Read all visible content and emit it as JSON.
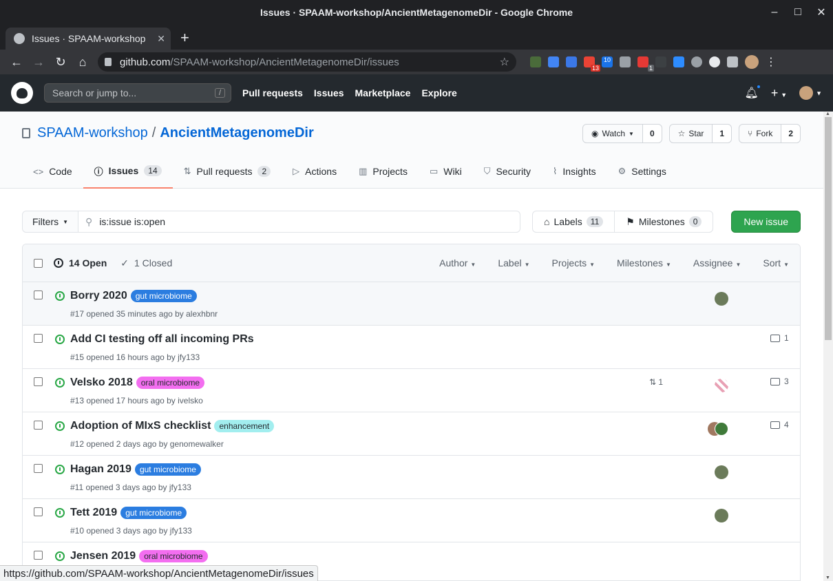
{
  "window": {
    "title": "Issues · SPAAM-workshop/AncientMetagenomeDir - Google Chrome"
  },
  "browser": {
    "tab_title": "Issues · SPAAM-workshop",
    "url_host": "github.com",
    "url_path": "/SPAAM-workshop/AncientMetagenomeDir/issues",
    "ext_badge_mail": "13",
    "ext_badge_calendar": "10",
    "ext_badge_other": "1"
  },
  "gh": {
    "search_placeholder": "Search or jump to...",
    "slash": "/",
    "nav": [
      "Pull requests",
      "Issues",
      "Marketplace",
      "Explore"
    ]
  },
  "repo": {
    "owner": "SPAAM-workshop",
    "sep": "/",
    "name": "AncientMetagenomeDir",
    "watch_label": "Watch",
    "watch_count": "0",
    "star_label": "Star",
    "star_count": "1",
    "fork_label": "Fork",
    "fork_count": "2",
    "tabs": {
      "code": "Code",
      "issues": "Issues",
      "issues_count": "14",
      "pulls": "Pull requests",
      "pulls_count": "2",
      "actions": "Actions",
      "projects": "Projects",
      "wiki": "Wiki",
      "security": "Security",
      "insights": "Insights",
      "settings": "Settings"
    }
  },
  "subnav": {
    "filters": "Filters",
    "query": "is:issue is:open",
    "labels": "Labels",
    "labels_count": "11",
    "milestones": "Milestones",
    "milestones_count": "0",
    "new_issue": "New issue"
  },
  "list_header": {
    "open": "14 Open",
    "closed": "1 Closed",
    "sorts": [
      "Author",
      "Label",
      "Projects",
      "Milestones",
      "Assignee",
      "Sort"
    ]
  },
  "issues": [
    {
      "title": "Borry 2020",
      "label": "gut microbiome",
      "meta": "#17 opened 35 minutes ago by alexhbnr"
    },
    {
      "title": "Add CI testing off all incoming PRs",
      "label": "",
      "meta": "#15 opened 16 hours ago by jfy133",
      "comments": "1"
    },
    {
      "title": "Velsko 2018",
      "label": "oral microbiome",
      "meta": "#13 opened 17 hours ago by ivelsko",
      "prs": "1",
      "comments": "3"
    },
    {
      "title": "Adoption of MIxS checklist",
      "label": "enhancement",
      "meta": "#12 opened 2 days ago by genomewalker",
      "comments": "4"
    },
    {
      "title": "Hagan 2019",
      "label": "gut microbiome",
      "meta": "#11 opened 3 days ago by jfy133"
    },
    {
      "title": "Tett 2019",
      "label": "gut microbiome",
      "meta": "#10 opened 3 days ago by jfy133"
    },
    {
      "title": "Jensen 2019",
      "label": "oral microbiome",
      "meta": ""
    }
  ],
  "colors": {
    "gut_microbiome": "#2b7de0",
    "oral_microbiome": "#f36ef0",
    "enhancement": "#a2eeef"
  },
  "status_url": "https://github.com/SPAAM-workshop/AncientMetagenomeDir/issues"
}
